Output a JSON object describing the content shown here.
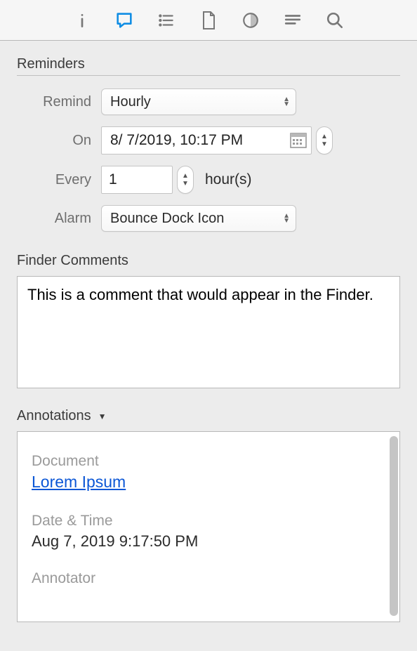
{
  "sections": {
    "reminders": "Reminders",
    "finderComments": "Finder Comments",
    "annotations": "Annotations"
  },
  "reminders": {
    "remindLabel": "Remind",
    "remindValue": "Hourly",
    "onLabel": "On",
    "onValue": "8/  7/2019, 10:17 PM",
    "everyLabel": "Every",
    "everyValue": "1",
    "everyUnit": "hour(s)",
    "alarmLabel": "Alarm",
    "alarmValue": "Bounce Dock Icon"
  },
  "finderComments": {
    "value": "This is a comment that would appear in the Finder."
  },
  "annotations": {
    "documentLabel": "Document",
    "documentValue": "Lorem Ipsum",
    "dateLabel": "Date & Time",
    "dateValue": "Aug 7, 2019 9:17:50 PM",
    "annotatorLabel": "Annotator"
  }
}
